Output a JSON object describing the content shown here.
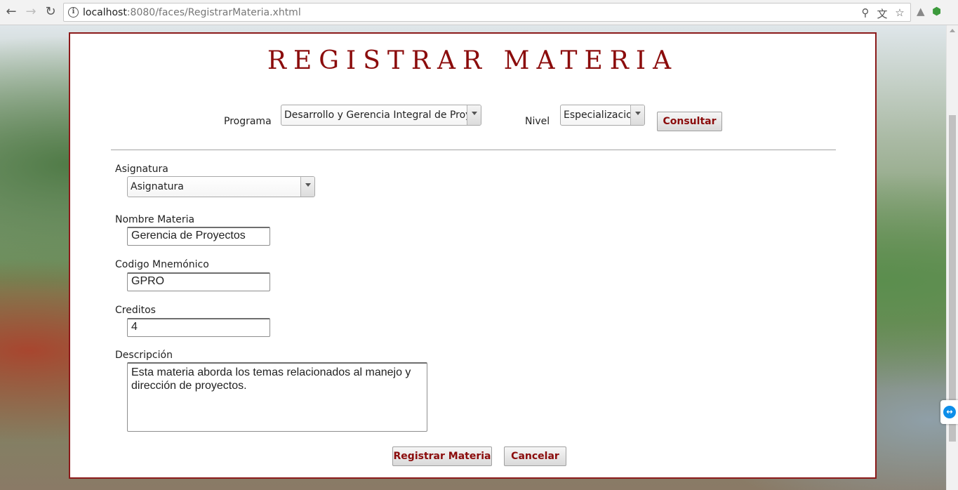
{
  "browser": {
    "url_host": "localhost",
    "url_rest": ":8080/faces/RegistrarMateria.xhtml",
    "back_icon": "back-arrow-icon",
    "forward_icon": "forward-arrow-icon",
    "reload_icon": "reload-icon"
  },
  "page": {
    "title": "REGISTRAR MATERIA"
  },
  "filters": {
    "programa_label": "Programa",
    "programa_value": "Desarrollo y Gerencia Integral de Proyec",
    "nivel_label": "Nivel",
    "nivel_value": "Especializacion",
    "consultar_label": "Consultar"
  },
  "form": {
    "asignatura_label": "Asignatura",
    "asignatura_value": "Asignatura",
    "nombre_label": "Nombre Materia",
    "nombre_value": "Gerencia de Proyectos",
    "codigo_label": "Codigo Mnemónico",
    "codigo_value": "GPRO",
    "creditos_label": "Creditos",
    "creditos_value": "4",
    "descripcion_label": "Descripción",
    "descripcion_value": "Esta materia aborda los temas relacionados al manejo y dirección de proyectos."
  },
  "actions": {
    "registrar_label": "Registrar Materia",
    "cancelar_label": "Cancelar"
  },
  "colors": {
    "accent": "#8b0c0c",
    "panel_border": "#8b1a1a"
  }
}
